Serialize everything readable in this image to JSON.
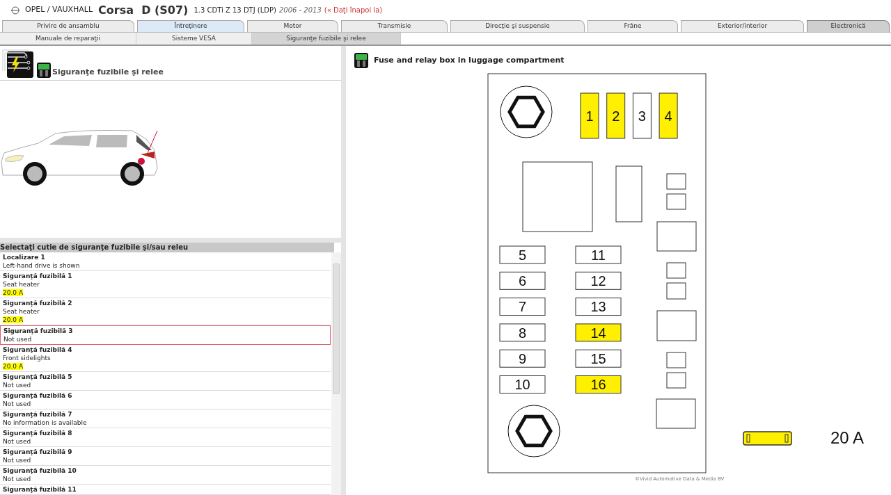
{
  "header": {
    "make": "OPEL / VAUXHALL",
    "model": "Corsa  D (S07)",
    "engine": "1.3 CDTi Z 13 DTJ (LDP)",
    "years": "2006 - 2013",
    "back_link": "(« Daţi înapoi la)"
  },
  "main_tabs": [
    {
      "label": "Privire de ansamblu",
      "selected": false,
      "hovered": false
    },
    {
      "label": "Întreţinere",
      "selected": false,
      "hovered": true
    },
    {
      "label": "Motor",
      "selected": false,
      "hovered": false
    },
    {
      "label": "Transmisie",
      "selected": false,
      "hovered": false
    },
    {
      "label": "Direcţie şi suspensie",
      "selected": false,
      "hovered": false
    },
    {
      "label": "Frâne",
      "selected": false,
      "hovered": false
    },
    {
      "label": "Exterior/interior",
      "selected": false,
      "hovered": false
    },
    {
      "label": "Electronică",
      "selected": true,
      "hovered": false
    }
  ],
  "sub_tabs": [
    {
      "label": "Manuale de reparaţii",
      "selected": false
    },
    {
      "label": "Sisteme VESA",
      "selected": false
    },
    {
      "label": "Siguranţe fuzibile şi relee",
      "selected": true
    }
  ],
  "left_panel": {
    "title": "Siguranţe fuzibile şi relee",
    "list_header": "Selectaţi cutie de siguranţe fuzibile şi/sau releu",
    "items": [
      {
        "title": "Localizare 1",
        "description": "Left-hand drive is shown",
        "selected": false
      },
      {
        "title": "Siguranţă fuzibilă 1",
        "description": "Seat heater",
        "rating": "20.0 A",
        "selected": false
      },
      {
        "title": "Siguranţă fuzibilă 2",
        "description": "Seat heater",
        "rating": "20.0 A",
        "selected": false
      },
      {
        "title": "Siguranţă fuzibilă 3",
        "description": "Not used",
        "selected": true
      },
      {
        "title": "Siguranţă fuzibilă 4",
        "description": "Front sidelights",
        "rating": "20.0 A",
        "selected": false
      },
      {
        "title": "Siguranţă fuzibilă 5",
        "description": "Not used",
        "selected": false
      },
      {
        "title": "Siguranţă fuzibilă 6",
        "description": "Not used",
        "selected": false
      },
      {
        "title": "Siguranţă fuzibilă 7",
        "description": "No information is available",
        "selected": false
      },
      {
        "title": "Siguranţă fuzibilă 8",
        "description": "Not used",
        "selected": false
      },
      {
        "title": "Siguranţă fuzibilă 9",
        "description": "Not used",
        "selected": false
      },
      {
        "title": "Siguranţă fuzibilă 10",
        "description": "Not used",
        "selected": false
      },
      {
        "title": "Siguranţă fuzibilă 11",
        "selected": false
      }
    ]
  },
  "right_panel": {
    "title": "Fuse and relay box in luggage compartment",
    "top_fuses": [
      {
        "label": "1",
        "highlighted": true
      },
      {
        "label": "2",
        "highlighted": true
      },
      {
        "label": "3",
        "highlighted": false
      },
      {
        "label": "4",
        "highlighted": true
      }
    ],
    "left_column_fuses": [
      {
        "label": "5",
        "highlighted": false
      },
      {
        "label": "6",
        "highlighted": false
      },
      {
        "label": "7",
        "highlighted": false
      },
      {
        "label": "8",
        "highlighted": false
      },
      {
        "label": "9",
        "highlighted": false
      },
      {
        "label": "10",
        "highlighted": false
      }
    ],
    "right_column_fuses": [
      {
        "label": "11",
        "highlighted": false
      },
      {
        "label": "12",
        "highlighted": false
      },
      {
        "label": "13",
        "highlighted": false
      },
      {
        "label": "14",
        "highlighted": true
      },
      {
        "label": "15",
        "highlighted": false
      },
      {
        "label": "16",
        "highlighted": true
      }
    ],
    "legend_rating": "20 A",
    "copyright": "©Vivid Automotive Data & Media BV"
  }
}
